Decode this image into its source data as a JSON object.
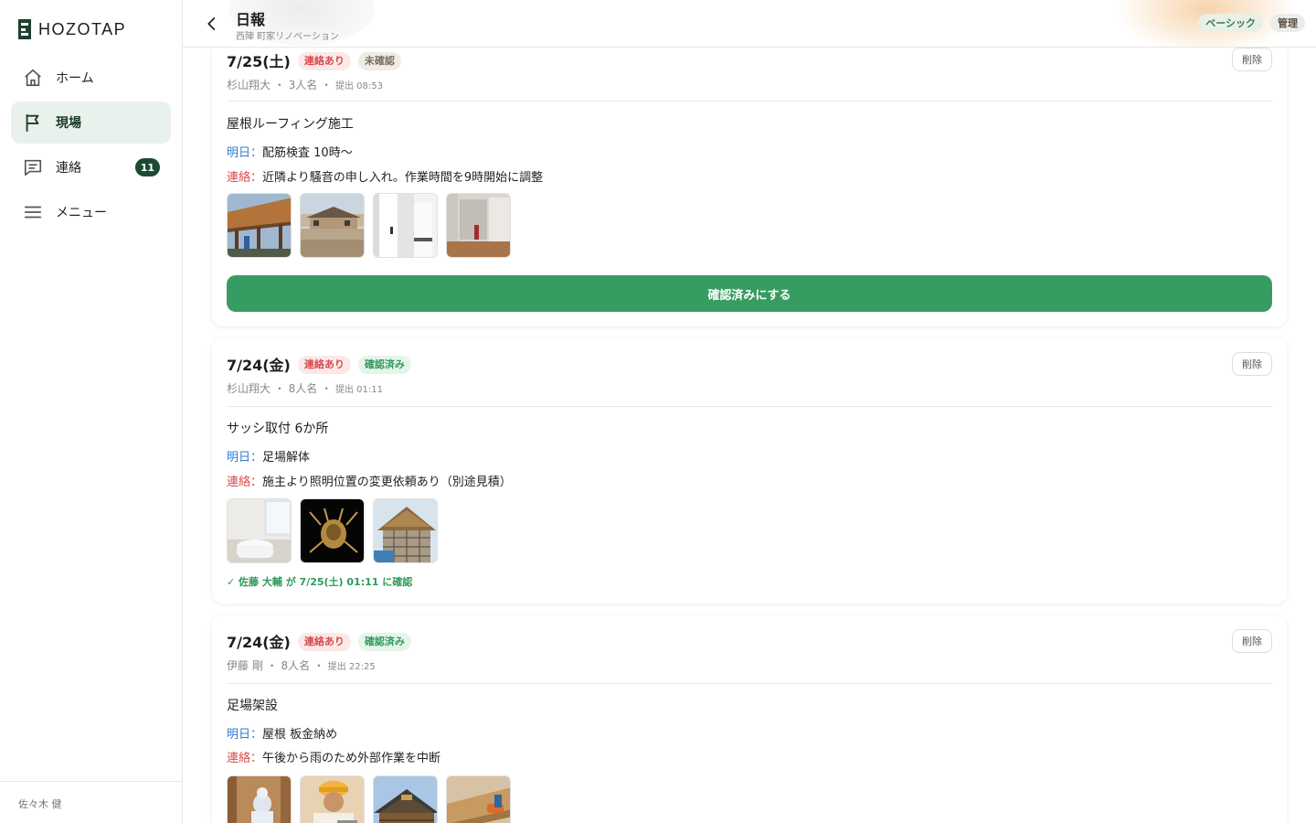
{
  "brand": {
    "name": "HOZOTAP"
  },
  "nav": [
    {
      "label": "ホーム",
      "icon": "home-icon"
    },
    {
      "label": "現場",
      "icon": "flag-icon",
      "active": true
    },
    {
      "label": "連絡",
      "icon": "chat-icon",
      "badge": "11"
    },
    {
      "label": "メニュー",
      "icon": "menu-icon"
    }
  ],
  "sidebar_footer": {
    "user": "佐々木 健"
  },
  "header": {
    "title": "日報",
    "subtitle": "西陣 町家リノベーション",
    "plan_badge": "ベーシック",
    "admin_badge": "管理"
  },
  "labels": {
    "delete": "削除",
    "tomorrow": "明日：",
    "contact": "連絡：",
    "confirm_button": "確認済みにする"
  },
  "reports": [
    {
      "date": "7/25(土)",
      "tags": [
        "連絡あり",
        "未確認"
      ],
      "author": "杉山翔大",
      "crew": "3人名",
      "submitted": "提出 08:53",
      "work": "屋根ルーフィング施工",
      "tomorrow": "配筋検査 10時〜",
      "contact": "近隣より騒音の申し入れ。作業時間を9時開始に調整"
    },
    {
      "date": "7/24(金)",
      "tags": [
        "連絡あり",
        "確認済み"
      ],
      "author": "杉山翔大",
      "crew": "8人名",
      "submitted": "提出 01:11",
      "work": "サッシ取付 6か所",
      "tomorrow": "足場解体",
      "contact": "施主より照明位置の変更依頼あり（別途見積）",
      "confirmed_note": "✓ 佐藤 大輔 が 7/25(土) 01:11 に確認"
    },
    {
      "date": "7/24(金)",
      "tags": [
        "連絡あり",
        "確認済み"
      ],
      "author": "伊藤 剛",
      "crew": "8人名",
      "submitted": "提出 22:25",
      "work": "足場架設",
      "tomorrow": "屋根 板金納め",
      "contact": "午後から雨のため外部作業を中断"
    }
  ],
  "colors": {
    "accent_green": "#379c61",
    "nav_active_bg": "#e9f1ec",
    "tag_contact": "#d84c4c",
    "tomorrow_blue": "#2f7dd6",
    "badge_dark": "#1c4a33"
  }
}
